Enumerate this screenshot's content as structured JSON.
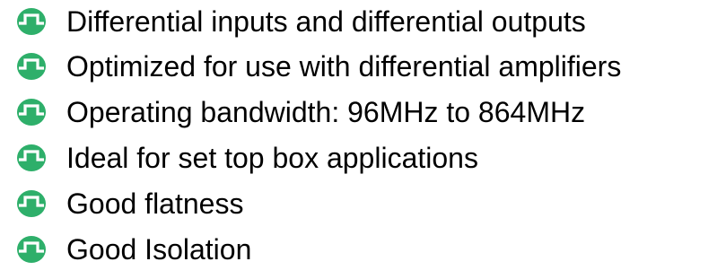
{
  "bullets": [
    {
      "text": "Differential inputs and differential outputs",
      "icon": "pulse-bullet-icon"
    },
    {
      "text": "Optimized for use with differential amplifiers",
      "icon": "pulse-bullet-icon"
    },
    {
      "text": "Operating bandwidth: 96MHz to 864MHz",
      "icon": "pulse-bullet-icon"
    },
    {
      "text": "Ideal for set top box applications",
      "icon": "pulse-bullet-icon"
    },
    {
      "text": "Good flatness",
      "icon": "pulse-bullet-icon"
    },
    {
      "text": "Good Isolation",
      "icon": "pulse-bullet-icon"
    }
  ],
  "colors": {
    "bullet_fill": "#2eaf6a",
    "bullet_glyph": "#ffffff",
    "text": "#000000"
  }
}
